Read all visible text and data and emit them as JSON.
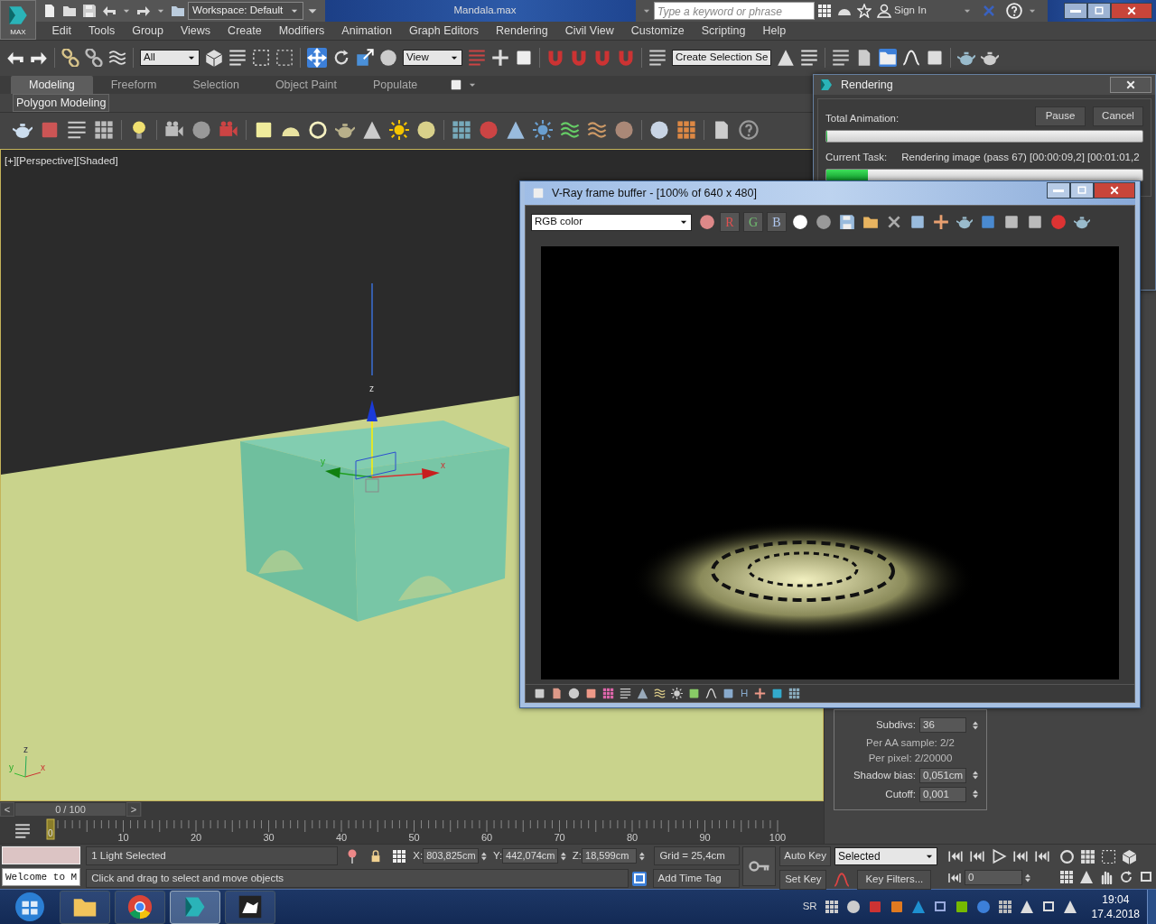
{
  "title_bar": {
    "app_button": "MAX",
    "workspace": "Workspace: Default",
    "document_title": "Mandala.max",
    "search": {
      "placeholder": "Type a keyword or phrase"
    },
    "sign_in": "Sign In"
  },
  "menu_bar": [
    "Edit",
    "Tools",
    "Group",
    "Views",
    "Create",
    "Modifiers",
    "Animation",
    "Graph Editors",
    "Rendering",
    "Civil View",
    "Customize",
    "Scripting",
    "Help"
  ],
  "main_toolbar": {
    "selection_filter": "All",
    "reference_coordinate_system": "View",
    "named_selection_set": "Create Selection Se"
  },
  "ribbon": {
    "tabs": [
      {
        "label": "Modeling",
        "selected": true
      },
      {
        "label": "Freeform",
        "selected": false
      },
      {
        "label": "Selection",
        "selected": false
      },
      {
        "label": "Object Paint",
        "selected": false
      },
      {
        "label": "Populate",
        "selected": false
      }
    ],
    "panel_label": "Polygon Modeling"
  },
  "viewport": {
    "label": "[+][Perspective][Shaded]",
    "gizmo_axes": [
      "x",
      "y",
      "z"
    ],
    "tripod_axes": [
      "x",
      "y",
      "z"
    ]
  },
  "command_panel": {
    "rows": [
      {
        "kind": "spinner",
        "label": "Subdivs:",
        "value": "36"
      },
      {
        "kind": "note",
        "text": "Per AA sample: 2/2"
      },
      {
        "kind": "note",
        "text": "Per pixel: 2/20000"
      },
      {
        "kind": "spinner",
        "label": "Shadow bias:",
        "value": "0,051cm"
      },
      {
        "kind": "spinner",
        "label": "Cutoff:",
        "value": "0,001"
      }
    ]
  },
  "time_slider": {
    "level": 0,
    "prev": "<",
    "position": "0 / 100",
    "next": ">"
  },
  "track_bar": {
    "current_frame": "0",
    "ticks": [
      "10",
      "20",
      "30",
      "40",
      "50",
      "60",
      "70",
      "80",
      "90",
      "100"
    ]
  },
  "status_bar": {
    "welcome": "Welcome to M",
    "selection": "1 Light Selected",
    "prompt": "Click and drag to select and move objects",
    "coordinates": [
      {
        "axis": "X:",
        "value": "803,825cm"
      },
      {
        "axis": "Y:",
        "value": "442,074cm"
      },
      {
        "axis": "Z:",
        "value": "18,599cm"
      }
    ],
    "grid": "Grid = 25,4cm",
    "time_tag": "Add Time Tag",
    "auto_key": "Auto Key",
    "set_key": "Set Key",
    "key_set": "Selected",
    "key_filters": "Key Filters...",
    "current_frame": "0"
  },
  "taskbar": {
    "apps": [
      {
        "kind": "folder",
        "selected": false
      },
      {
        "kind": "browser",
        "selected": false
      },
      {
        "kind": "max",
        "selected": true
      },
      {
        "kind": "rhino",
        "selected": false
      }
    ],
    "language": "SR",
    "time": "19:04",
    "date": "17.4.2018"
  },
  "rendering_dialog": {
    "title": "Rendering",
    "total_label": "Total Animation:",
    "pause": "Pause",
    "cancel": "Cancel",
    "total_progress": {
      "level": 0
    },
    "task_label": "Current Task:",
    "task_text": "Rendering image (pass 67) [00:00:09,2] [00:01:01,2",
    "task_progress": {
      "level": 0.13
    }
  },
  "frame_buffer": {
    "title": "V-Ray frame buffer - [100% of 640 x 480]",
    "channel_mode": "RGB color",
    "channels": [
      {
        "label": "R",
        "color": "#e05050"
      },
      {
        "label": "G",
        "color": "#70c070"
      },
      {
        "label": "B",
        "color": "#b0c8f0"
      }
    ],
    "footer_label": "H"
  }
}
